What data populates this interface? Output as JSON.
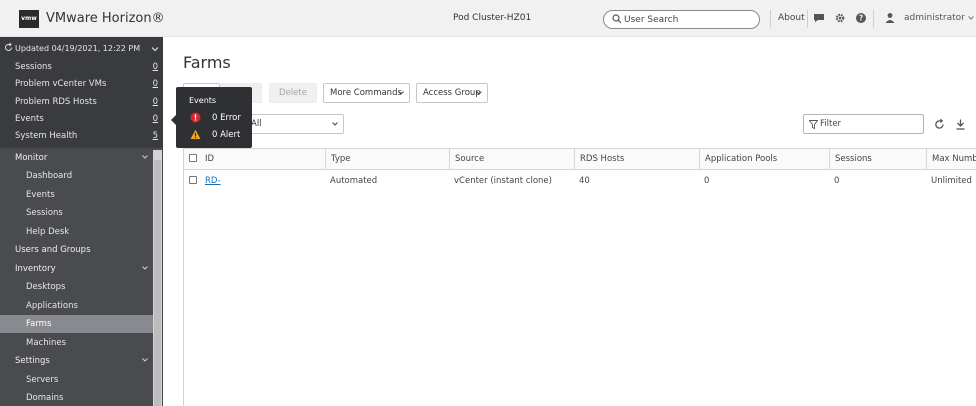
{
  "header": {
    "logo_text": "vmw",
    "app_title": "VMware Horizon®",
    "pod": "Pod Cluster-HZ01",
    "search_placeholder": "User Search",
    "about": "About",
    "user": "administrator"
  },
  "status": {
    "updated": "Updated 04/19/2021, 12:22 PM",
    "items": [
      {
        "label": "Sessions",
        "count": "0"
      },
      {
        "label": "Problem vCenter VMs",
        "count": "0"
      },
      {
        "label": "Problem RDS Hosts",
        "count": "0"
      },
      {
        "label": "Events",
        "count": "0"
      },
      {
        "label": "System Health",
        "count": "5"
      }
    ]
  },
  "nav": {
    "monitor": "Monitor",
    "dashboard": "Dashboard",
    "events": "Events",
    "sessions": "Sessions",
    "help_desk": "Help Desk",
    "users_groups": "Users and Groups",
    "inventory": "Inventory",
    "desktops": "Desktops",
    "applications": "Applications",
    "farms": "Farms",
    "machines": "Machines",
    "settings": "Settings",
    "servers": "Servers",
    "domains": "Domains"
  },
  "tooltip": {
    "title": "Events",
    "error": "0 Error",
    "alert": "0 Alert"
  },
  "main": {
    "title": "Farms",
    "delete": "Delete",
    "more_commands": "More Commands",
    "access_group": "Access Group",
    "select_value": "All",
    "filter_placeholder": "Filter"
  },
  "table": {
    "columns": [
      "ID",
      "Type",
      "Source",
      "RDS Hosts",
      "Application Pools",
      "Sessions",
      "Max Number"
    ],
    "rows": [
      {
        "id": "RD-",
        "type": "Automated",
        "source": "vCenter (instant clone)",
        "rds_hosts": "40",
        "app_pools": "0",
        "sessions": "0",
        "max": "Unlimited"
      }
    ]
  },
  "colors": {
    "sidebar": "#3e3f42",
    "active_nav": "#888a8f",
    "link": "#1a6fb3",
    "error": "#d9262c",
    "alert": "#f0a428"
  }
}
